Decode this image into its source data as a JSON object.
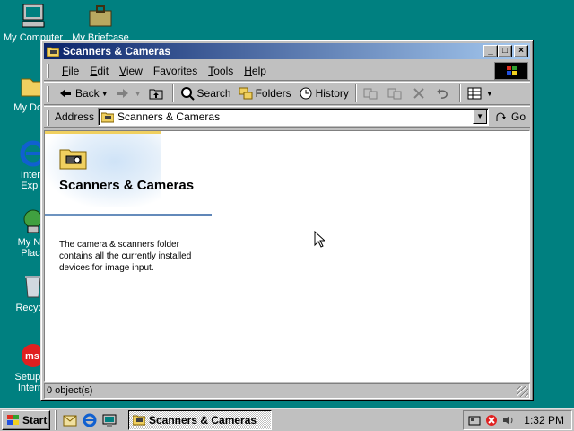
{
  "desktop": {
    "icons": [
      {
        "label": "My Computer",
        "icon": "my-computer-icon"
      },
      {
        "label": "My Briefcase",
        "icon": "briefcase-icon"
      },
      {
        "label": "My Docu",
        "icon": "my-documents-icon"
      },
      {
        "label": "Intern\nExplo",
        "icon": "internet-explorer-icon"
      },
      {
        "label": "My Net\nPlace",
        "icon": "network-places-icon"
      },
      {
        "label": "Recycle",
        "icon": "recycle-bin-icon"
      },
      {
        "label": "Setup M\nInterne",
        "icon": "msn-icon"
      }
    ]
  },
  "window": {
    "title": "Scanners & Cameras",
    "controls": {
      "minimize": "_",
      "maximize": "□",
      "close": "×"
    },
    "menu": [
      {
        "label": "File",
        "key": "F",
        "rest": "ile"
      },
      {
        "label": "Edit",
        "key": "E",
        "rest": "dit"
      },
      {
        "label": "View",
        "key": "V",
        "rest": "iew"
      },
      {
        "label": "Favorites",
        "key": "F",
        "rest": "avorites",
        "pre": "",
        "underline_index": 1
      },
      {
        "label": "Tools",
        "key": "T",
        "rest": "ools"
      },
      {
        "label": "Help",
        "key": "H",
        "rest": "elp"
      }
    ],
    "toolbar": {
      "back": "Back",
      "search": "Search",
      "folders": "Folders",
      "history": "History"
    },
    "address": {
      "label": "Address",
      "value": "Scanners & Cameras",
      "go": "Go"
    },
    "pane": {
      "title": "Scanners & Cameras",
      "description": "The camera & scanners folder contains all the currently installed devices for image input."
    },
    "status": "0 object(s)"
  },
  "taskbar": {
    "start": "Start",
    "task": "Scanners & Cameras",
    "clock": "1:32 PM"
  },
  "colors": {
    "desktop": "#008080",
    "title_start": "#0a246a",
    "title_end": "#a6caf0",
    "chrome": "#c0c0c0"
  }
}
